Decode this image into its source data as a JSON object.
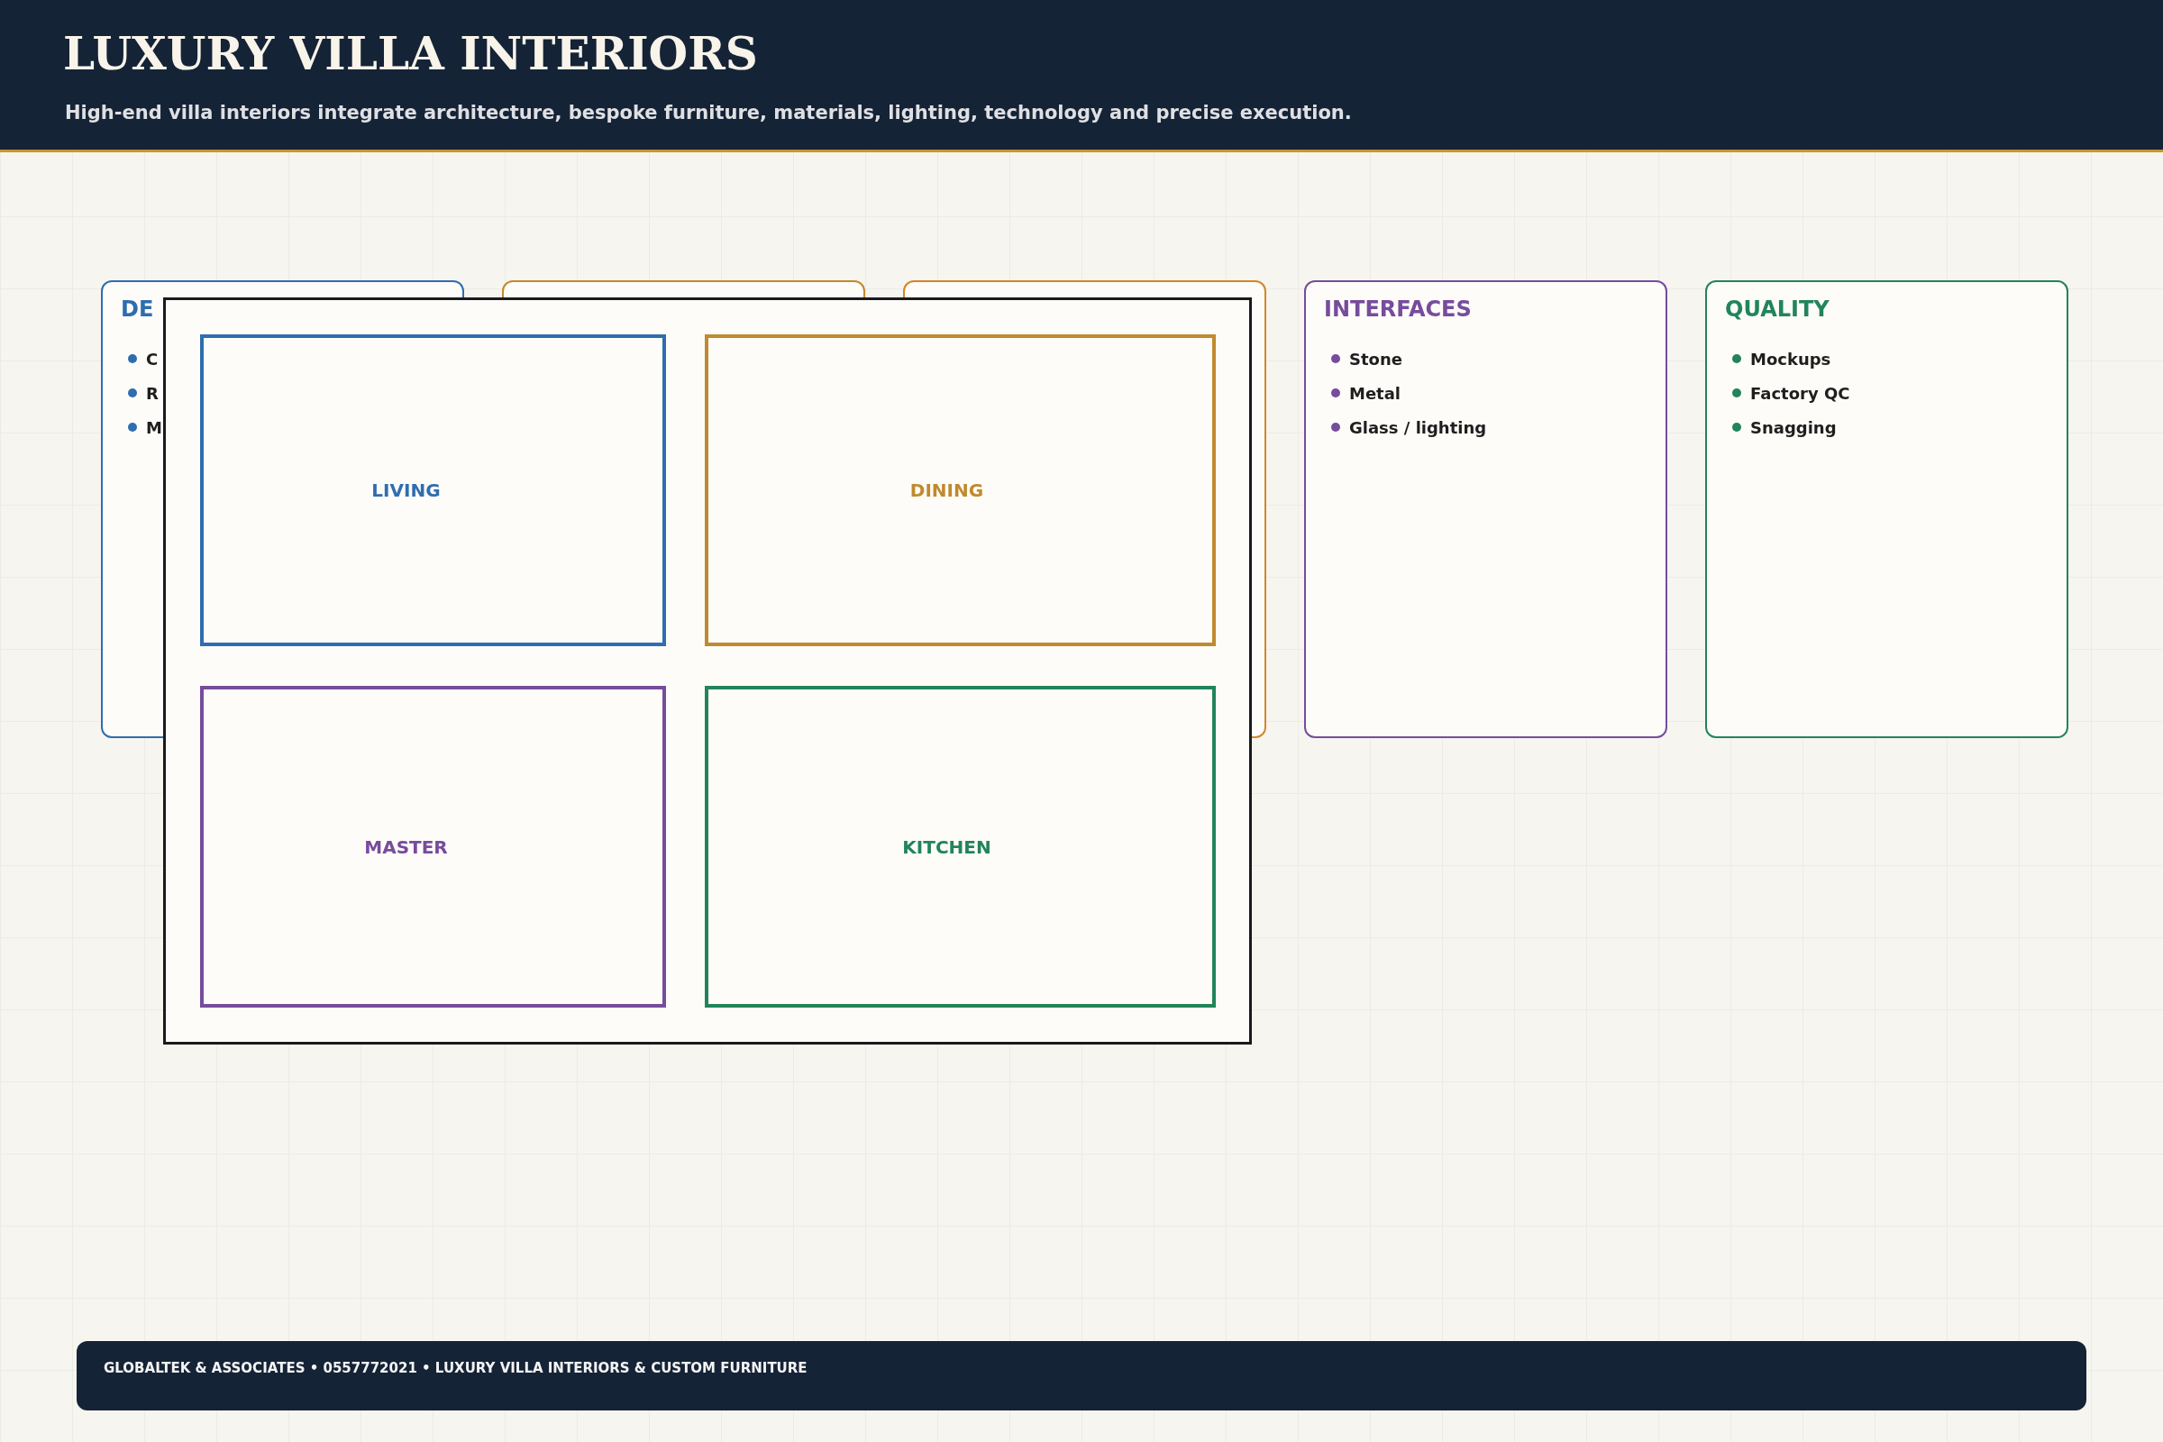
{
  "header": {
    "title": "LUXURY VILLA INTERIORS",
    "subtitle": "High-end villa interiors integrate architecture, bespoke furniture, materials, lighting, technology and precise execution."
  },
  "cards": [
    {
      "title": "DE",
      "color": "#2f6db0",
      "items": [
        "C",
        "R",
        "M"
      ]
    },
    {
      "color": "#c08a2e"
    },
    {
      "color": "#d4862a"
    },
    {
      "title": "INTERFACES",
      "color": "#774c9c",
      "items": [
        "Stone",
        "Metal",
        "Glass / lighting"
      ]
    },
    {
      "title": "QUALITY",
      "color": "#22845a",
      "items": [
        "Mockups",
        "Factory QC",
        "Snagging"
      ]
    }
  ],
  "plan": {
    "rooms": [
      {
        "label": "LIVING",
        "color": "#2f6db0"
      },
      {
        "label": "DINING",
        "color": "#c08a2e"
      },
      {
        "label": "MASTER",
        "color": "#774c9c"
      },
      {
        "label": "KITCHEN",
        "color": "#22845a"
      }
    ]
  },
  "footer": {
    "text": "GLOBALTEK & ASSOCIATES • 0557772021 • LUXURY VILLA INTERIORS & CUSTOM FURNITURE"
  }
}
